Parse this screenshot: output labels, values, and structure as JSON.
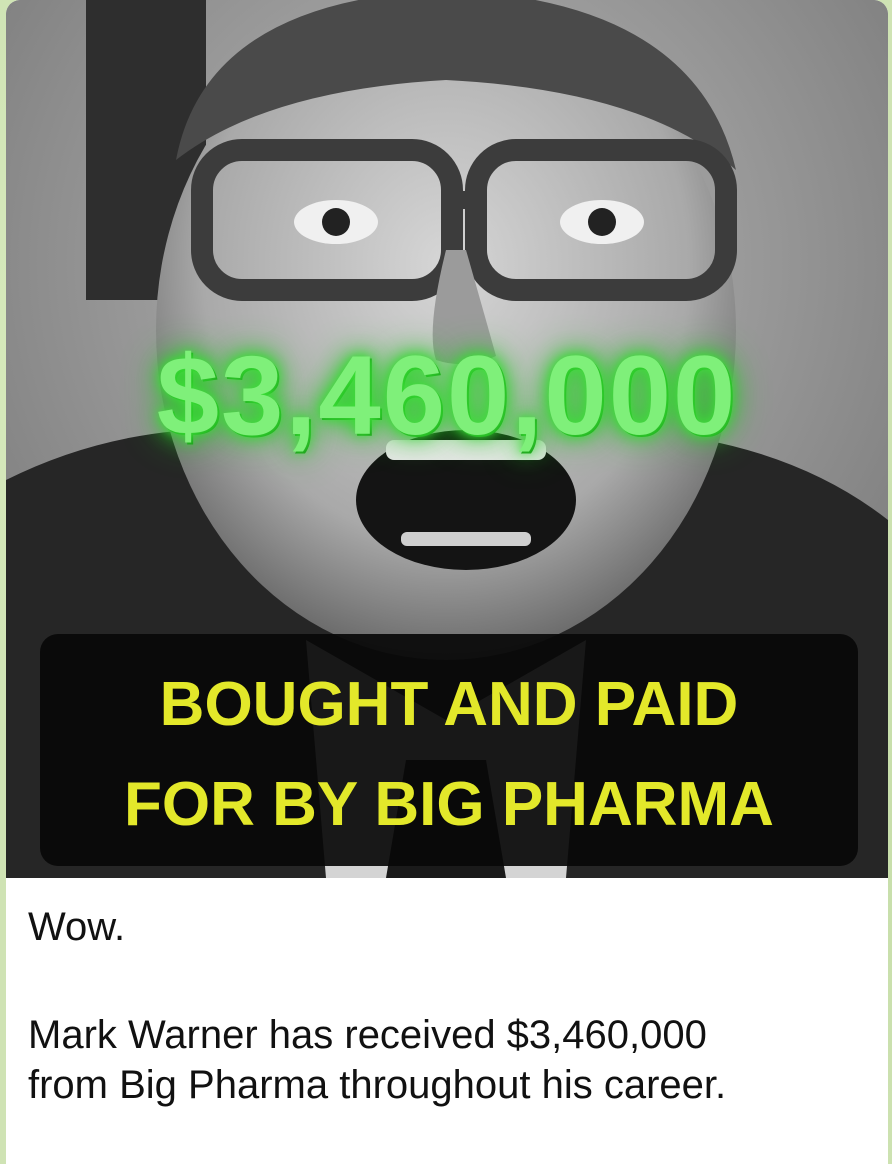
{
  "photo": {
    "description_icon": "portrait-photo",
    "amount_overlay": "$3,460,000",
    "caption": {
      "line1": "BOUGHT AND PAID",
      "line2": "FOR BY BIG PHARMA"
    }
  },
  "message": {
    "line1": "Wow.",
    "line2": "Mark Warner has received $3,460,000",
    "line3": "from Big Pharma throughout his career."
  },
  "colors": {
    "amount_green": "#7ff07a",
    "caption_yellow": "#e3e82a",
    "chat_background": "#cfe3b4"
  }
}
